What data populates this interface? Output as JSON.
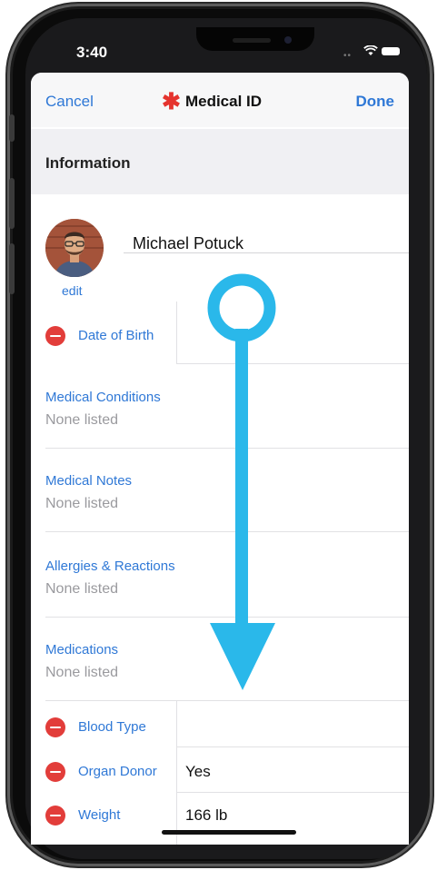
{
  "status_bar": {
    "time": "3:40",
    "signal_icon": "cellular-dots-icon",
    "wifi_icon": "wifi-icon",
    "battery_icon": "battery-icon"
  },
  "nav": {
    "cancel_label": "Cancel",
    "title": "Medical ID",
    "title_icon": "medical-star-icon",
    "done_label": "Done"
  },
  "section": {
    "title": "Information"
  },
  "profile": {
    "name": "Michael Potuck",
    "edit_label": "edit",
    "avatar_icon": "avatar-photo"
  },
  "fields": {
    "date_of_birth": {
      "label": "Date of Birth",
      "value": ""
    },
    "medical_conditions": {
      "label": "Medical Conditions",
      "value": "None listed"
    },
    "medical_notes": {
      "label": "Medical Notes",
      "value": "None listed"
    },
    "allergies": {
      "label": "Allergies & Reactions",
      "value": "None listed"
    },
    "medications": {
      "label": "Medications",
      "value": "None listed"
    },
    "blood_type": {
      "label": "Blood Type",
      "value": ""
    },
    "organ_donor": {
      "label": "Organ Donor",
      "value": "Yes"
    },
    "weight": {
      "label": "Weight",
      "value": "166 lb"
    }
  },
  "colors": {
    "accent": "#2f78d6",
    "destructive": "#e23d3a",
    "star": "#e5332e",
    "overlay_arrow": "#2ab8ea",
    "placeholder": "#9a9a9e"
  },
  "overlay": {
    "scroll_arrow_icon": "scroll-down-arrow-icon"
  }
}
